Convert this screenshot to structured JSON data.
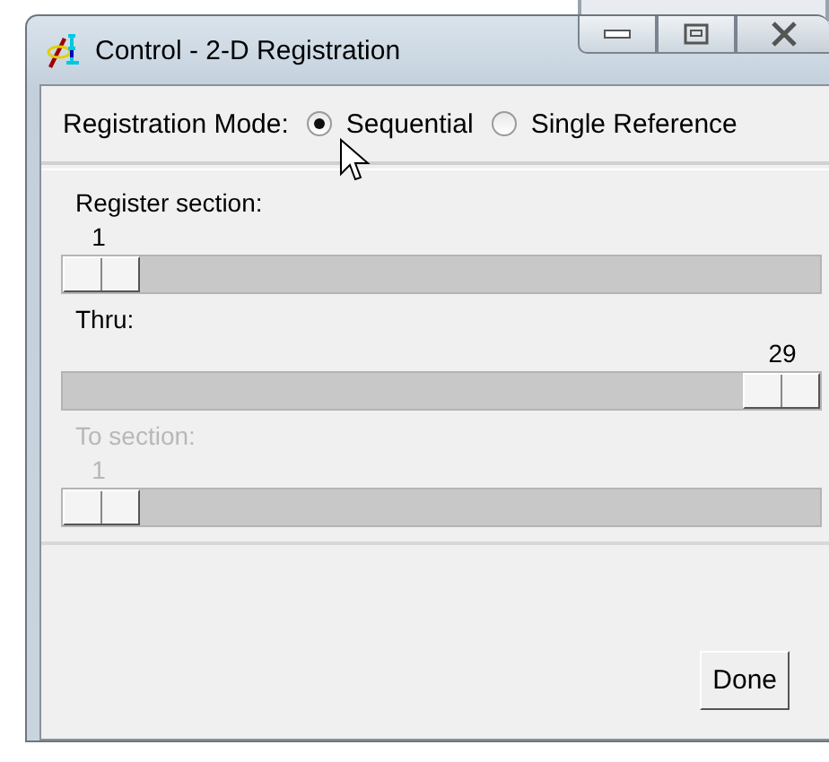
{
  "window": {
    "title": "Control - 2-D Registration"
  },
  "registration_mode": {
    "label": "Registration Mode:",
    "options": [
      {
        "label": "Sequential",
        "selected": true
      },
      {
        "label": "Single Reference",
        "selected": false
      }
    ]
  },
  "sliders": [
    {
      "label": "Register section:",
      "value": "1",
      "level": 0,
      "disabled": false
    },
    {
      "label": "Thru:",
      "value": "29",
      "level": 1,
      "disabled": false
    },
    {
      "label": "To section:",
      "value": "1",
      "level": 0,
      "disabled": true
    }
  ],
  "buttons": [
    "Done"
  ]
}
